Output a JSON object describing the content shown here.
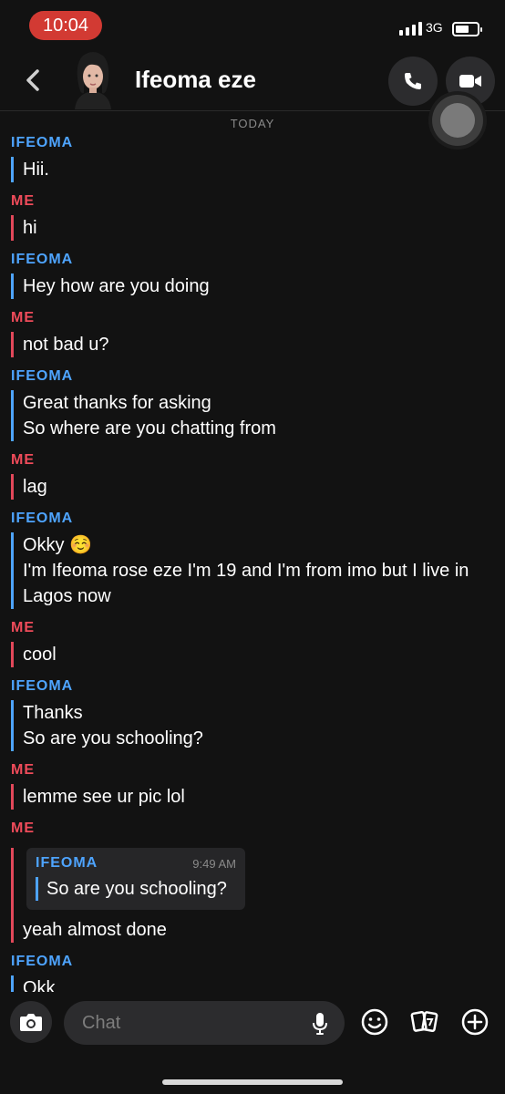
{
  "status": {
    "time": "10:04",
    "network": "3G"
  },
  "header": {
    "contact_name": "Ifeoma eze"
  },
  "divider": {
    "today": "TODAY"
  },
  "messages": [
    {
      "sender": "IFEOMA",
      "lines": [
        "Hii."
      ]
    },
    {
      "sender": "ME",
      "lines": [
        "hi"
      ]
    },
    {
      "sender": "IFEOMA",
      "lines": [
        "Hey how are you doing"
      ]
    },
    {
      "sender": "ME",
      "lines": [
        "not bad u?"
      ]
    },
    {
      "sender": "IFEOMA",
      "lines": [
        "Great thanks for asking",
        "So where are you chatting from"
      ]
    },
    {
      "sender": "ME",
      "lines": [
        "lag"
      ]
    },
    {
      "sender": "IFEOMA",
      "lines": [
        "Okky ☺️",
        "I'm Ifeoma rose eze I'm 19 and I'm from imo but I live in",
        "Lagos now"
      ]
    },
    {
      "sender": "ME",
      "lines": [
        "cool"
      ]
    },
    {
      "sender": "IFEOMA",
      "lines": [
        "Thanks",
        "So are you schooling?"
      ]
    },
    {
      "sender": "ME",
      "lines": [
        "lemme see ur pic lol"
      ]
    },
    {
      "sender": "ME",
      "quote": {
        "sender": "IFEOMA",
        "time": "9:49 AM",
        "text": "So are you schooling?"
      },
      "lines": [
        "yeah almost done"
      ]
    },
    {
      "sender": "IFEOMA",
      "lines": [
        "Okk"
      ]
    }
  ],
  "composer": {
    "placeholder": "Chat"
  },
  "colors": {
    "them": "#4ea4ff",
    "me": "#ef4b5a",
    "background": "#121212",
    "status_pill": "#d23a33"
  }
}
